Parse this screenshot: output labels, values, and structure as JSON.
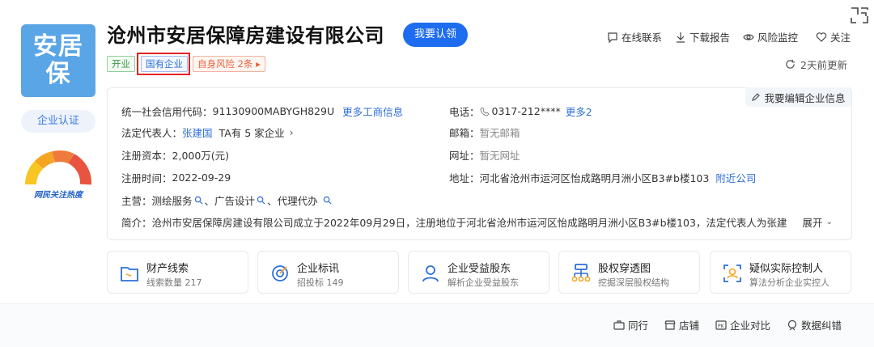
{
  "logo": {
    "line1": "安居",
    "line2": "保"
  },
  "certification_label": "企业认证",
  "heat_label": "网民关注热度",
  "company": {
    "name": "沧州市安居保障房建设有限公司",
    "claim_label": "我要认领",
    "tags": {
      "status": "开业",
      "type": "国有企业",
      "risk": "自身风险 2条 ▸"
    }
  },
  "header_actions": {
    "contact": "在线联系",
    "report": "下载报告",
    "monitor": "风险监控",
    "follow": "关注"
  },
  "update_text": "2天前更新",
  "edit_label": "我要编辑企业信息",
  "info": {
    "credit_code_label": "统一社会信用代码：",
    "credit_code": "91130900MABYGH829U",
    "more_business": "更多工商信息",
    "phone_label": "电话：",
    "phone": "0317-212****",
    "more_phone": "更多2",
    "rep_label": "法定代表人：",
    "rep_name": "张建国",
    "rep_companies": "TA有 5 家企业",
    "email_label": "邮箱：",
    "email": "暂无邮箱",
    "capital_label": "注册资本：",
    "capital": "2,000万(元)",
    "website_label": "网址：",
    "website": "暂无网址",
    "reg_time_label": "注册时间：",
    "reg_time": "2022-09-29",
    "address_label": "地址：",
    "address": "河北省沧州市运河区怡成路明月洲小区B3#b楼103",
    "nearby": "附近公司",
    "business_label": "主营：",
    "business": [
      "测绘服务",
      "广告设计",
      "代理代办"
    ],
    "intro_label": "简介：",
    "intro": "沧州市安居保障房建设有限公司成立于2022年09月29日，注册地位于河北省沧州市运河区怡成路明月洲小区B3#b楼103，法定代表人为张建",
    "expand": "展开"
  },
  "cards": [
    {
      "title": "财产线索",
      "sub": "线索数量 217",
      "icon": "property-icon"
    },
    {
      "title": "企业标讯",
      "sub": "招投标 149",
      "icon": "bid-icon"
    },
    {
      "title": "企业受益股东",
      "sub": "解析企业受益股东",
      "icon": "shareholder-icon"
    },
    {
      "title": "股权穿透图",
      "sub": "挖掘深层股权结构",
      "icon": "equity-icon"
    },
    {
      "title": "疑似实际控制人",
      "sub": "算法分析企业实控人",
      "icon": "controller-icon"
    }
  ],
  "footer_actions": {
    "peers": "同行",
    "store": "店铺",
    "compare": "企业对比",
    "correction": "数据纠错"
  },
  "colors": {
    "primary": "#1e6cf0",
    "logo_bg": "#5aa5e6",
    "highlight": "#e32222"
  }
}
